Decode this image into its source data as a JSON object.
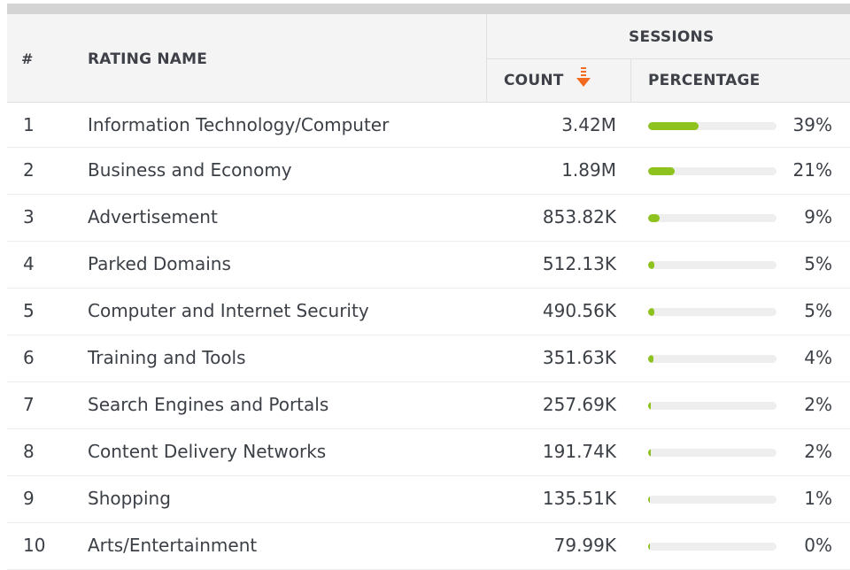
{
  "header": {
    "num": "#",
    "rating_name": "RATING NAME",
    "sessions": "SESSIONS",
    "count": "COUNT",
    "percentage": "PERCENTAGE",
    "sort_icon": "sort-descending-icon"
  },
  "colors": {
    "bar_fill": "#8dc21f",
    "bar_track": "#eeeeee",
    "sort_icon": "#f26b21",
    "header_bg": "#f4f4f4"
  },
  "rows": [
    {
      "num": "1",
      "name": "Information Technology/Computer",
      "count": "3.42M",
      "pct": "39%",
      "fraction": 0.39
    },
    {
      "num": "2",
      "name": "Business and Economy",
      "count": "1.89M",
      "pct": "21%",
      "fraction": 0.21
    },
    {
      "num": "3",
      "name": "Advertisement",
      "count": "853.82K",
      "pct": "9%",
      "fraction": 0.09
    },
    {
      "num": "4",
      "name": "Parked Domains",
      "count": "512.13K",
      "pct": "5%",
      "fraction": 0.05
    },
    {
      "num": "5",
      "name": "Computer and Internet Security",
      "count": "490.56K",
      "pct": "5%",
      "fraction": 0.05
    },
    {
      "num": "6",
      "name": "Training and Tools",
      "count": "351.63K",
      "pct": "4%",
      "fraction": 0.04
    },
    {
      "num": "7",
      "name": "Search Engines and Portals",
      "count": "257.69K",
      "pct": "2%",
      "fraction": 0.02
    },
    {
      "num": "8",
      "name": "Content Delivery Networks",
      "count": "191.74K",
      "pct": "2%",
      "fraction": 0.02
    },
    {
      "num": "9",
      "name": "Shopping",
      "count": "135.51K",
      "pct": "1%",
      "fraction": 0.01
    },
    {
      "num": "10",
      "name": "Arts/Entertainment",
      "count": "79.99K",
      "pct": "0%",
      "fraction": 0.0
    }
  ]
}
